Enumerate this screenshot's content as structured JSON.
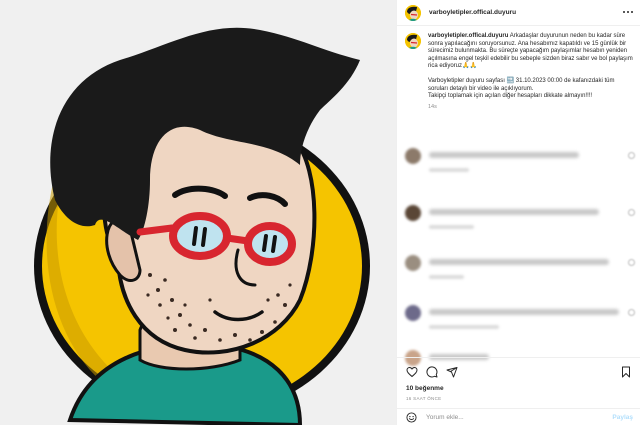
{
  "post": {
    "username": "varboyletipler.offical.duyuru",
    "caption_text": "Arkadaşlar duyurunun neden bu kadar süre sonra yapılacağını soruyorsunuz. Ana hesabımız kapatıldı ve 15 günlük bir sürecimiz bulunmakta. Bu süreçte yapacağım paylaşımlar hesabın yeniden açılmasına engel teşkil edebilir bu sebeple sizden biraz sabır ve bol paylaşım rica ediyoruz🙏🙏",
    "caption_text_2": "Varboyletipler duyuru sayfası 🔜 31.10.2023 00:00 de kafanızdaki tüm soruları detaylı bir video ile açıklıyorum.",
    "caption_text_3": "Takipçi toplamak için açılan diğer hesapları dikkate almayın!!!!",
    "caption_time": "14s",
    "likes": "10 beğenme",
    "time_ago": "16 SAAT ÖNCE",
    "comment_placeholder": "Yorum ekle...",
    "share_label": "Paylaş"
  },
  "comments": [
    {
      "name": "comment-1",
      "avatar_color": "#8c7a6a"
    },
    {
      "name": "comment-2",
      "avatar_color": "#5a4636"
    },
    {
      "name": "comment-3",
      "avatar_color": "#9a8e80"
    },
    {
      "name": "comment-4",
      "avatar_color": "#6d6a8a"
    },
    {
      "name": "comment-5",
      "avatar_color": "#c9a48a"
    }
  ],
  "icons": {
    "like": "heart-icon",
    "comment": "comment-icon",
    "share": "send-icon",
    "save": "bookmark-icon",
    "more": "more-options-icon",
    "emoji": "emoji-icon"
  },
  "colors": {
    "illustration_yellow": "#f5c400",
    "hair": "#1a1a1a",
    "glasses_red": "#d8262f",
    "shirt_teal": "#1a9a8a",
    "share_button": "#b2dffc"
  }
}
